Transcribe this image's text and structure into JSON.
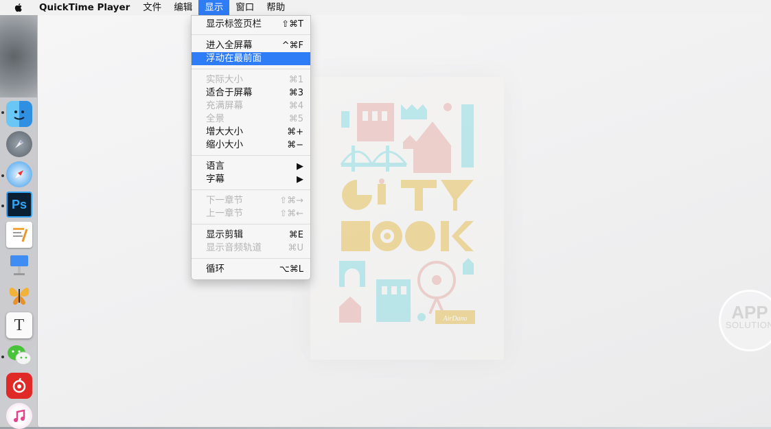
{
  "menubar": {
    "app_name": "QuickTime Player",
    "menus": [
      {
        "label": "文件"
      },
      {
        "label": "编辑"
      },
      {
        "label": "显示"
      },
      {
        "label": "窗口"
      },
      {
        "label": "帮助"
      }
    ]
  },
  "view_menu": {
    "items": [
      {
        "label": "显示标签页栏",
        "shortcut": "⇧⌘T",
        "state": "enabled"
      },
      {
        "label": "进入全屏幕",
        "shortcut": "^⌘F",
        "state": "enabled"
      },
      {
        "label": "浮动在最前面",
        "shortcut": "",
        "state": "highlighted"
      },
      {
        "label": "实际大小",
        "shortcut": "⌘1",
        "state": "disabled"
      },
      {
        "label": "适合于屏幕",
        "shortcut": "⌘3",
        "state": "enabled"
      },
      {
        "label": "充满屏幕",
        "shortcut": "⌘4",
        "state": "disabled"
      },
      {
        "label": "全景",
        "shortcut": "⌘5",
        "state": "disabled"
      },
      {
        "label": "增大大小",
        "shortcut": "⌘+",
        "state": "enabled"
      },
      {
        "label": "缩小大小",
        "shortcut": "⌘−",
        "state": "enabled"
      },
      {
        "label": "语言",
        "shortcut": "▶",
        "state": "enabled"
      },
      {
        "label": "字幕",
        "shortcut": "▶",
        "state": "enabled"
      },
      {
        "label": "下一章节",
        "shortcut": "⇧⌘→",
        "state": "disabled"
      },
      {
        "label": "上一章节",
        "shortcut": "⇧⌘←",
        "state": "disabled"
      },
      {
        "label": "显示剪辑",
        "shortcut": "⌘E",
        "state": "enabled"
      },
      {
        "label": "显示音频轨道",
        "shortcut": "⌘U",
        "state": "disabled"
      },
      {
        "label": "循环",
        "shortcut": "⌥⌘L",
        "state": "enabled"
      }
    ]
  },
  "dock": {
    "items": [
      {
        "name": "finder-icon"
      },
      {
        "name": "launchpad-icon"
      },
      {
        "name": "safari-icon"
      },
      {
        "name": "photoshop-icon",
        "text": "Ps"
      },
      {
        "name": "pages-icon"
      },
      {
        "name": "keynote-icon"
      },
      {
        "name": "tes-butterfly-icon"
      },
      {
        "name": "typora-icon",
        "text": "T"
      },
      {
        "name": "wechat-icon"
      },
      {
        "name": "netease-music-icon"
      },
      {
        "name": "itunes-icon"
      }
    ]
  },
  "poster": {
    "word1": "CITY",
    "word2": "BOOK",
    "brand": "AirDano"
  },
  "watermark": {
    "line1": "APP",
    "line2": "SOLUTION"
  },
  "colors": {
    "menu_highlight": "#2e7cf6",
    "poster_pink": "#e8b3ad",
    "poster_cyan": "#8fdde3",
    "poster_gold": "#e6c25a"
  }
}
